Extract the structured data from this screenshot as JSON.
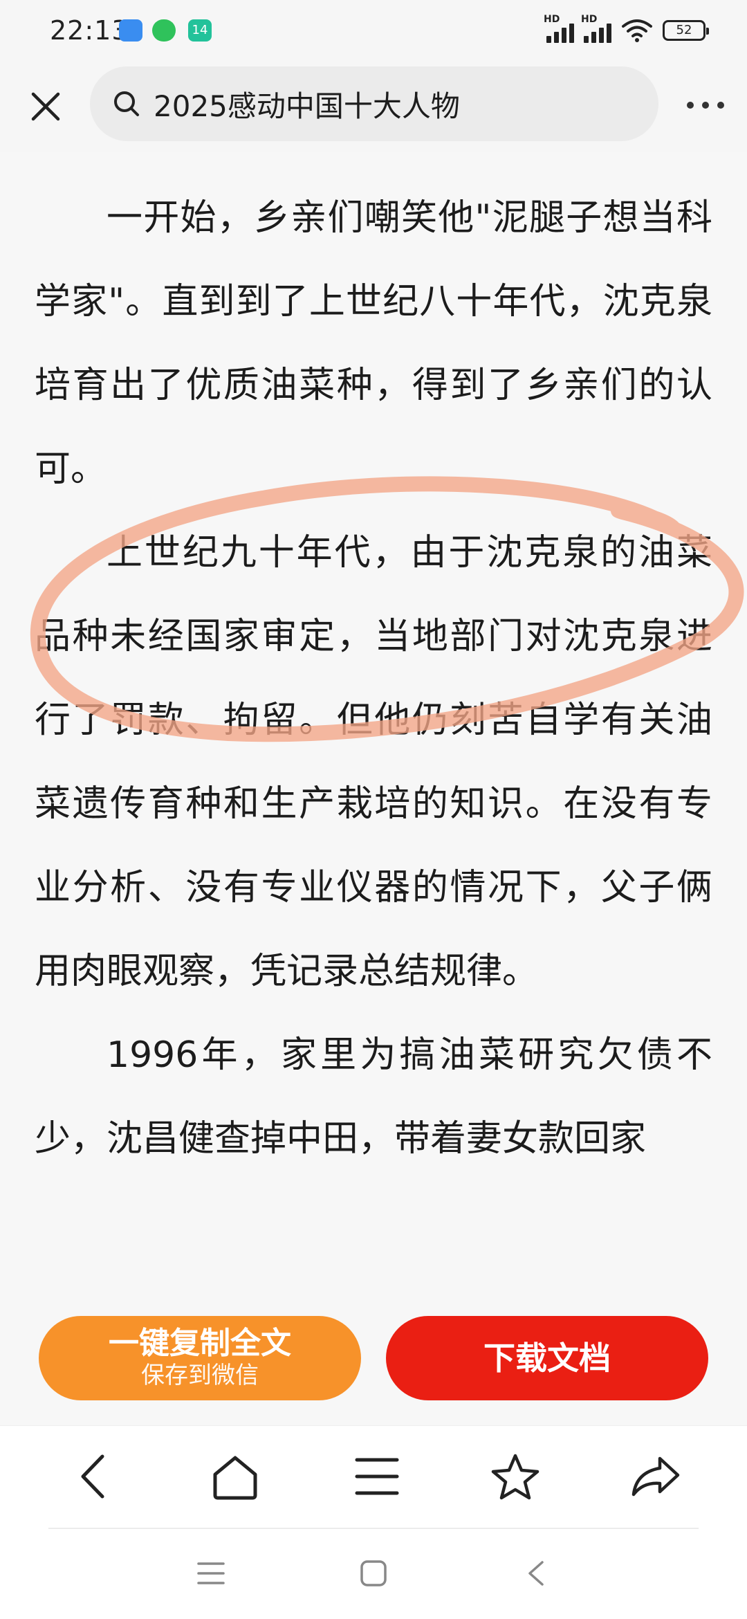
{
  "status_bar": {
    "time": "22:13",
    "badge_number": "14",
    "signal1_label": "HD",
    "signal2_label": "HD",
    "battery": "52"
  },
  "header": {
    "close_icon": "close-icon",
    "search_query": "2025感动中国十大人物",
    "more_icon": "more-dots-icon"
  },
  "article": {
    "paragraphs": [
      "一开始，乡亲们嘲笑他\"泥腿子想当科学家\"。直到到了上世纪八十年代，沈克泉培育出了优质油菜种，得到了乡亲们的认可。",
      "上世纪九十年代，由于沈克泉的油菜品种未经国家审定，当地部门对沈克泉进行了罚款、拘留。但他仍刻苦自学有关油菜遗传育种和生产栽培的知识。在没有专业分析、没有专业仪器的情况下，父子俩用肉眼观察，凭记录总结规律。",
      "1996年，家里为搞油菜研究欠债不少，沈昌健查掉中田，带着妻女款回家"
    ],
    "annotation_color": "#f3a586"
  },
  "actions": {
    "copy_line1": "一键复制全文",
    "copy_line2": "保存到微信",
    "download": "下载文档",
    "copy_color": "#f7922a",
    "download_color": "#ea1f13"
  },
  "toolbar": {
    "items": [
      "back-icon",
      "home-icon",
      "menu-icon",
      "star-icon",
      "share-icon"
    ]
  },
  "system_nav": {
    "items": [
      "recents-icon",
      "home-square-icon",
      "back-triangle-icon"
    ]
  }
}
